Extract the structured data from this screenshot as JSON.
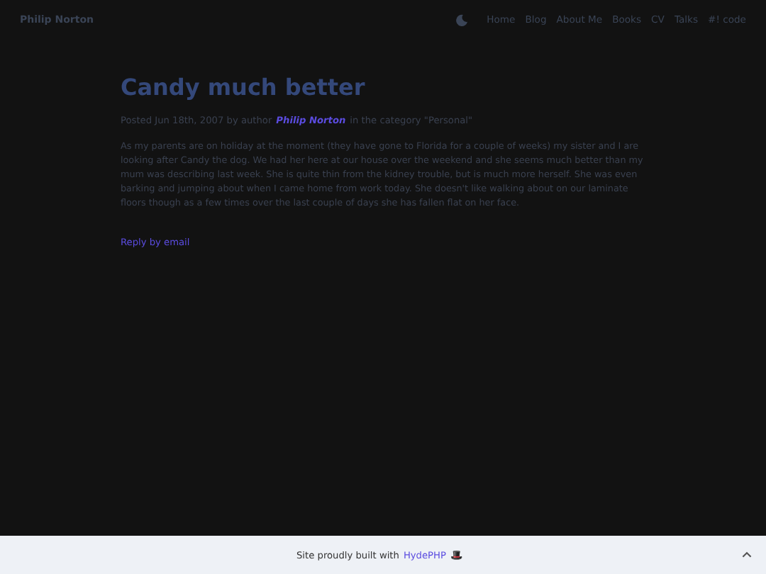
{
  "header": {
    "brand": "Philip Norton",
    "nav": [
      "Home",
      "Blog",
      "About Me",
      "Books",
      "CV",
      "Talks",
      "#! code"
    ]
  },
  "post": {
    "title": "Candy much better",
    "meta_before": "Posted Jun 18th, 2007 by author",
    "author": "Philip Norton",
    "meta_after": "in the category \"Personal\"",
    "body": "As my parents are on holiday at the moment (they have gone to Florida for a couple of weeks) my sister and I are looking after Candy the dog. We had her here at our house over the weekend and she seems much better than my mum was describing last week. She is quite thin from the kidney trouble, but is much more herself. She was even barking and jumping about when I came home from work today. She doesn't like walking about on our laminate floors though as a few times over the last couple of days she has fallen flat on her face.",
    "reply": "Reply by email"
  },
  "footer": {
    "text": "Site proudly built with",
    "link": "HydePHP",
    "emoji": "🎩"
  }
}
